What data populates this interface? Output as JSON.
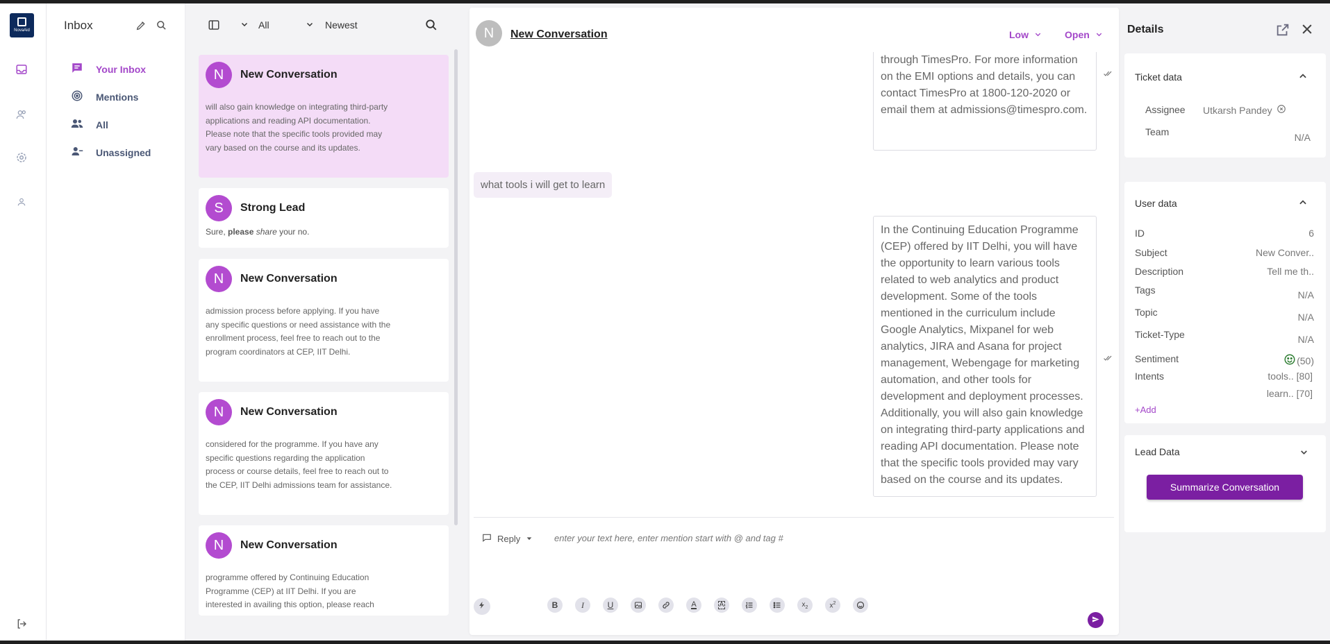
{
  "rail": {
    "logo_text": "NovaAid",
    "icons": [
      "inbox-icon",
      "contacts-icon",
      "settings-icon",
      "profile-icon",
      "logout-icon"
    ]
  },
  "inbox_nav": {
    "title": "Inbox",
    "items": [
      {
        "label": "Your Inbox",
        "icon": "chat-icon",
        "active": true
      },
      {
        "label": "Mentions",
        "icon": "mentions-icon",
        "active": false
      },
      {
        "label": "All",
        "icon": "group-icon",
        "active": false
      },
      {
        "label": "Unassigned",
        "icon": "user-minus-icon",
        "active": false
      }
    ]
  },
  "list": {
    "filter": "All",
    "sort": "Newest",
    "conversations": [
      {
        "avatar": "N",
        "title": "New Conversation",
        "preview": "will also gain knowledge on integrating third-party applications and reading API documentation. Please note that the specific tools provided may vary based on the course and its updates.",
        "active": true
      },
      {
        "avatar": "S",
        "title": "Strong Lead",
        "preview_parts": [
          "Sure, ",
          "please",
          " ",
          "share",
          " your no."
        ],
        "active": false
      },
      {
        "avatar": "N",
        "title": "New Conversation",
        "preview": "admission process before applying. If you have any specific questions or need assistance with the enrollment process, feel free to reach out to the program coordinators at CEP, IIT Delhi.",
        "active": false
      },
      {
        "avatar": "N",
        "title": "New Conversation",
        "preview": "considered for the programme. If you have any specific questions regarding the application process or course details, feel free to reach out to the CEP, IIT Delhi admissions team for assistance.",
        "active": false
      },
      {
        "avatar": "N",
        "title": "New Conversation",
        "preview": "programme offered by Continuing Education Programme (CEP) at IIT Delhi. If you are interested in availing this option, please reach",
        "active": false
      }
    ]
  },
  "chat": {
    "avatar": "N",
    "title": "New Conversation",
    "priority": "Low",
    "status": "Open",
    "messages": {
      "bot_1": "Education Programme (CEP), IIT Delhi through TimesPro. For more information on the EMI options and details, you can contact TimesPro at 1800-120-2020 or email them at admissions@timespro.com.",
      "user_1": "what tools i will get to learn",
      "bot_2": "In the Continuing Education Programme (CEP) offered by IIT Delhi, you will have the opportunity to learn various tools related to web analytics and product development. Some of the tools mentioned in the curriculum include Google Analytics, Mixpanel for web analytics, JIRA and Asana for project management, Webengage for marketing automation, and other tools for development and deployment processes. Additionally, you will also gain knowledge on integrating third-party applications and reading API documentation. Please note that the specific tools provided may vary based on the course and its updates."
    },
    "reply_mode": "Reply",
    "reply_placeholder": "enter your text here, enter mention start with @ and tag #",
    "format_tools": [
      "B",
      "I",
      "U",
      "image",
      "link",
      "font-color",
      "highlight",
      "ordered-list",
      "bullet-list",
      "subscript",
      "superscript",
      "emoji"
    ]
  },
  "details": {
    "title": "Details",
    "ticket": {
      "heading": "Ticket data",
      "assignee_label": "Assignee",
      "assignee_value": "Utkarsh Pandey",
      "team_label": "Team",
      "team_value": "N/A"
    },
    "user": {
      "heading": "User data",
      "rows": [
        {
          "key": "ID",
          "value": "6"
        },
        {
          "key": "Subject",
          "value": "New Conver.."
        },
        {
          "key": "Description",
          "value": "Tell me th.."
        },
        {
          "key": "Tags",
          "value": "N/A"
        },
        {
          "key": "Topic",
          "value": "N/A"
        },
        {
          "key": "Ticket-Type",
          "value": "N/A"
        },
        {
          "key": "Sentiment",
          "value": "(50)"
        },
        {
          "key": "Intents",
          "value": "tools.. [80]"
        },
        {
          "key": "",
          "value": "learn.. [70]"
        }
      ],
      "add_label": "+Add"
    },
    "lead": {
      "heading": "Lead Data"
    },
    "summarize_label": "Summarize Conversation"
  },
  "colors": {
    "accent": "#a347c9",
    "button": "#7b1fa2",
    "active_card": "#f4dcf7"
  }
}
